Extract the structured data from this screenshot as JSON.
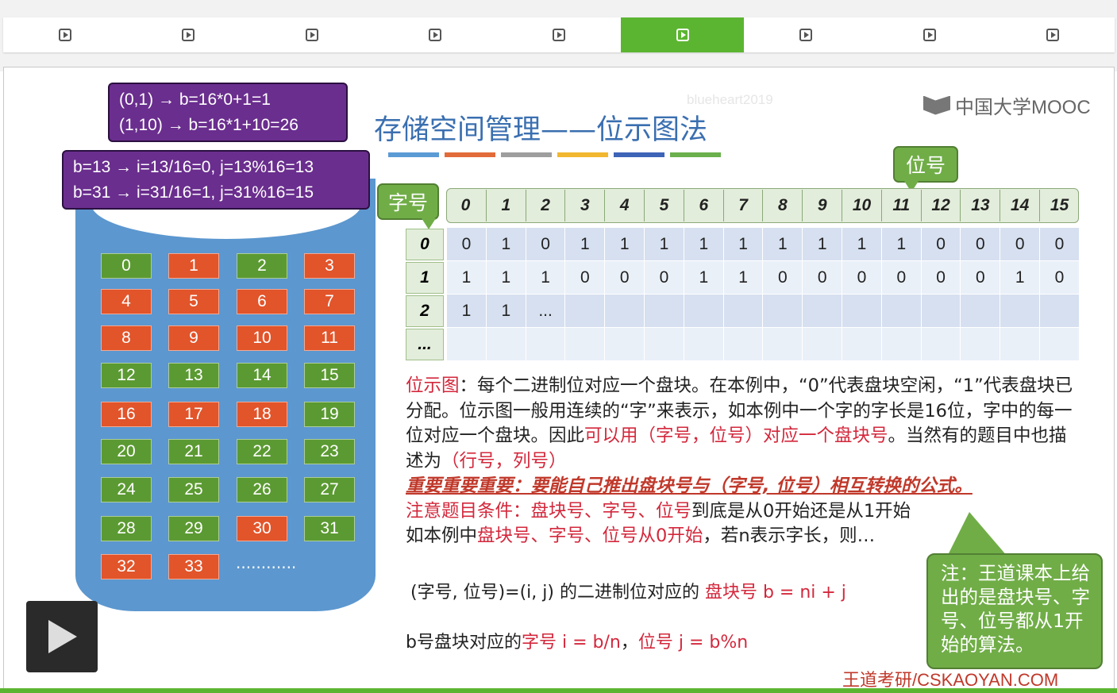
{
  "tabs": {
    "count": 9,
    "active_index": 5
  },
  "slide": {
    "title": "存储空间管理——位示图法",
    "watermark": "blueheart2019",
    "logo": "中国大学MOOC",
    "box1": {
      "line1": "(0,1) → b=16*0+1=1",
      "line2": "(1,10) → b=16*1+10=26"
    },
    "box2": {
      "line1": "b=13 → i=13/16=0, j=13%16=13",
      "line2": "b=31 → i=31/16=1, j=31%16=15"
    },
    "label_word": "字号",
    "label_bit": "位号",
    "blocks": [
      {
        "n": "0",
        "c": "g"
      },
      {
        "n": "1",
        "c": "o"
      },
      {
        "n": "2",
        "c": "g"
      },
      {
        "n": "3",
        "c": "o"
      },
      {
        "n": "4",
        "c": "o"
      },
      {
        "n": "5",
        "c": "o"
      },
      {
        "n": "6",
        "c": "o"
      },
      {
        "n": "7",
        "c": "o"
      },
      {
        "n": "8",
        "c": "o"
      },
      {
        "n": "9",
        "c": "o"
      },
      {
        "n": "10",
        "c": "o"
      },
      {
        "n": "11",
        "c": "o"
      },
      {
        "n": "12",
        "c": "g"
      },
      {
        "n": "13",
        "c": "g"
      },
      {
        "n": "14",
        "c": "g"
      },
      {
        "n": "15",
        "c": "g"
      },
      {
        "n": "16",
        "c": "o"
      },
      {
        "n": "17",
        "c": "o"
      },
      {
        "n": "18",
        "c": "o"
      },
      {
        "n": "19",
        "c": "g"
      },
      {
        "n": "20",
        "c": "g"
      },
      {
        "n": "21",
        "c": "g"
      },
      {
        "n": "22",
        "c": "g"
      },
      {
        "n": "23",
        "c": "g"
      },
      {
        "n": "24",
        "c": "g"
      },
      {
        "n": "25",
        "c": "g"
      },
      {
        "n": "26",
        "c": "g"
      },
      {
        "n": "27",
        "c": "g"
      },
      {
        "n": "28",
        "c": "g"
      },
      {
        "n": "29",
        "c": "g"
      },
      {
        "n": "30",
        "c": "o"
      },
      {
        "n": "31",
        "c": "g"
      },
      {
        "n": "32",
        "c": "o"
      },
      {
        "n": "33",
        "c": "o"
      }
    ],
    "blocks_more": "............",
    "bitmap": {
      "col_headers": [
        "0",
        "1",
        "2",
        "3",
        "4",
        "5",
        "6",
        "7",
        "8",
        "9",
        "10",
        "11",
        "12",
        "13",
        "14",
        "15"
      ],
      "row_headers": [
        "0",
        "1",
        "2",
        "..."
      ],
      "rows": [
        [
          "0",
          "1",
          "0",
          "1",
          "1",
          "1",
          "1",
          "1",
          "1",
          "1",
          "1",
          "1",
          "0",
          "0",
          "0",
          "0"
        ],
        [
          "1",
          "1",
          "1",
          "0",
          "0",
          "0",
          "1",
          "1",
          "0",
          "0",
          "0",
          "0",
          "0",
          "0",
          "1",
          "0"
        ],
        [
          "1",
          "1",
          "...",
          "",
          "",
          "",
          "",
          "",
          "",
          "",
          "",
          "",
          "",
          "",
          "",
          ""
        ],
        [
          "",
          "",
          "",
          "",
          "",
          "",
          "",
          "",
          "",
          "",
          "",
          "",
          "",
          "",
          "",
          ""
        ]
      ]
    },
    "text": {
      "p1_red": "位示图",
      "p1_rest": "：每个二进制位对应一个盘块。在本例中，“0”代表盘块空闲，“1”代表盘块已分配。位示图一般用连续的“字”来表示，如本例中一个字的字长是16位，字中的每一位对应一个盘块。因此",
      "p1_red2": "可以用（字号，位号）对应一个盘块号",
      "p1_mid": "。当然有的题目中也描述为",
      "p1_red3": "（行号，列号）",
      "emph": "重要重要重要：要能自己推出盘块号与（字号, 位号）相互转换的公式。",
      "p3_red": "注意题目条件：盘块号、字号、位号",
      "p3_rest": "到底是从0开始还是从1开始",
      "p4_a": "如本例中",
      "p4_red": "盘块号、字号、位号从0开始",
      "p4_b": "，若n表示字长，则…"
    },
    "formula1": {
      "a": "(字号, 位号)=(i, j) 的二进制位对应的 ",
      "red": "盘块号 b = ni + j"
    },
    "formula2": {
      "a": "b号盘块对应的",
      "red1": "字号 i = b/n",
      "sep": "，",
      "red2": "位号 j = b%n"
    },
    "note": "注：王道课本上给出的是盘块号、字号、位号都从1开始的算法。",
    "footer": "王道考研/CSKAOYAN.COM",
    "colors": {
      "accent_green": "#5cb531",
      "purple": "#6a2e8e",
      "red": "#d3283c",
      "title_blue": "#3a6fb0",
      "cylinder": "#5c97cf"
    }
  }
}
